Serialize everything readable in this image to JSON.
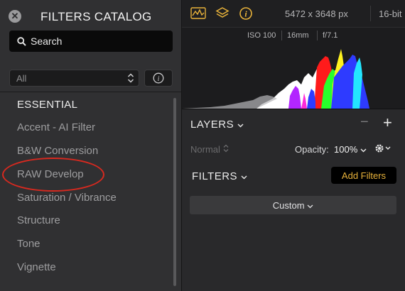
{
  "catalog": {
    "title": "FILTERS CATALOG",
    "search_placeholder": "Search",
    "category_selected": "All",
    "section_heading": "ESSENTIAL",
    "items": [
      {
        "label": "Accent - AI Filter"
      },
      {
        "label": "B&W Conversion"
      },
      {
        "label": "RAW Develop"
      },
      {
        "label": "Saturation / Vibrance"
      },
      {
        "label": "Structure"
      },
      {
        "label": "Tone"
      },
      {
        "label": "Vignette"
      }
    ]
  },
  "topbar": {
    "dimensions": "5472 x 3648 px",
    "bit_depth": "16-bit",
    "accent_color": "#e8b23a"
  },
  "histogram": {
    "iso": "ISO 100",
    "focal_length": "16mm",
    "aperture": "f/7.1"
  },
  "layers": {
    "title": "LAYERS",
    "blend_mode": "Normal",
    "opacity_label": "Opacity:",
    "opacity_value": "100%"
  },
  "filters": {
    "title": "FILTERS",
    "add_button": "Add Filters",
    "preset": "Custom"
  },
  "annotation": {
    "highlight_color": "#d8291f"
  }
}
